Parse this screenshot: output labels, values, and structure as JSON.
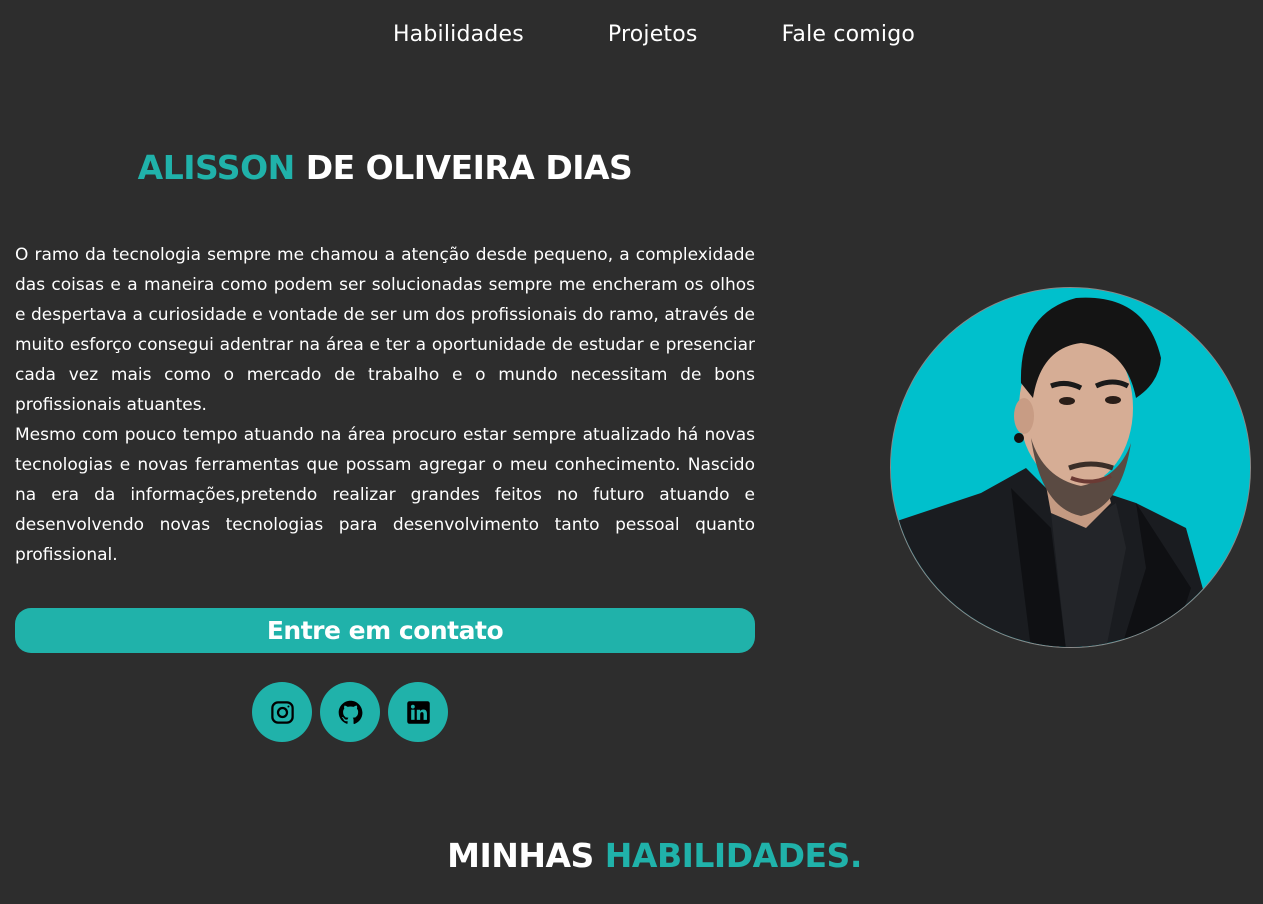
{
  "nav": {
    "items": [
      "Habilidades",
      "Projetos",
      "Fale comigo"
    ]
  },
  "hero": {
    "name_first": "ALISSON",
    "name_rest": "DE OLIVEIRA DIAS",
    "bio_paragraphs": [
      "O ramo da tecnologia sempre me chamou a atenção desde pequeno, a complexidade das coisas e a maneira como podem ser solucionadas sempre me encheram os olhos e despertava a curiosidade e vontade de ser um dos profissionais do ramo, através de muito esforço consegui adentrar na área e ter a oportunidade de estudar e presenciar cada vez mais como o mercado de trabalho e o mundo necessitam de bons profissionais atuantes.",
      "Mesmo com pouco tempo atuando na área procuro estar sempre atualizado há novas tecnologias e novas ferramentas que possam agregar o meu conhecimento. Nascido na era da informações,pretendo realizar grandes feitos no futuro atuando e desenvolvendo novas tecnologias para desenvolvimento tanto pessoal quanto profissional."
    ],
    "cta_label": "Entre em contato",
    "socials": [
      "instagram-icon",
      "github-icon",
      "linkedin-icon"
    ]
  },
  "skills": {
    "title_white": "MINHAS",
    "title_accent": "HABILIDADES."
  },
  "colors": {
    "background": "#2d2d2d",
    "accent": "#20b2aa",
    "photo_bg": "#00c0cc",
    "text": "#ffffff"
  }
}
